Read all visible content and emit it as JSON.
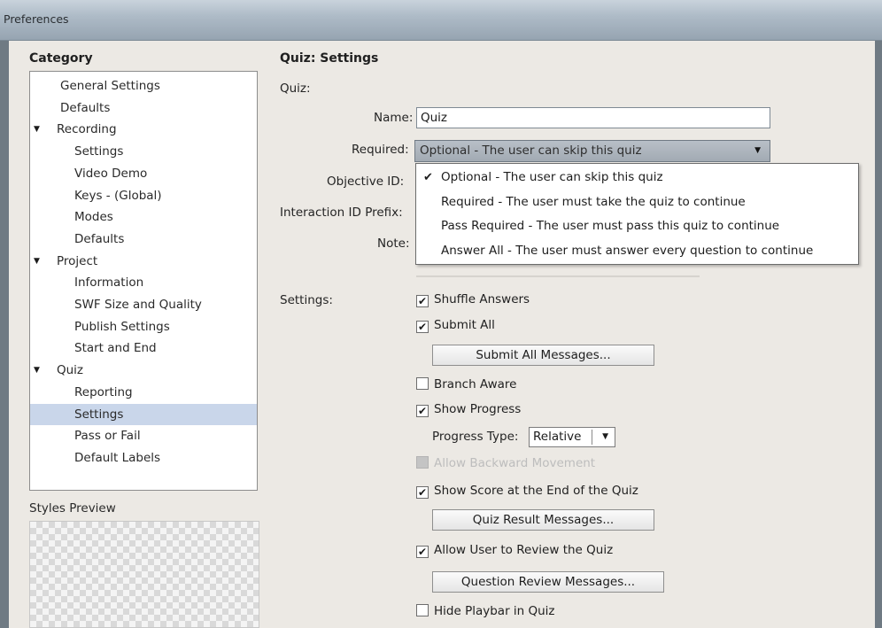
{
  "window": {
    "title": "Preferences"
  },
  "category": {
    "heading": "Category",
    "items": [
      {
        "label": "General Settings",
        "level": 1,
        "expander": ""
      },
      {
        "label": "Defaults",
        "level": 1,
        "expander": ""
      },
      {
        "label": "Recording",
        "level": 1,
        "expander": "▼"
      },
      {
        "label": "Settings",
        "level": 2,
        "expander": ""
      },
      {
        "label": "Video Demo",
        "level": 2,
        "expander": ""
      },
      {
        "label": "Keys - (Global)",
        "level": 2,
        "expander": ""
      },
      {
        "label": "Modes",
        "level": 2,
        "expander": ""
      },
      {
        "label": "Defaults",
        "level": 2,
        "expander": ""
      },
      {
        "label": "Project",
        "level": 1,
        "expander": "▼"
      },
      {
        "label": "Information",
        "level": 2,
        "expander": ""
      },
      {
        "label": "SWF Size and Quality",
        "level": 2,
        "expander": ""
      },
      {
        "label": "Publish Settings",
        "level": 2,
        "expander": ""
      },
      {
        "label": "Start and End",
        "level": 2,
        "expander": ""
      },
      {
        "label": "Quiz",
        "level": 1,
        "expander": "▼"
      },
      {
        "label": "Reporting",
        "level": 2,
        "expander": ""
      },
      {
        "label": "Settings",
        "level": 2,
        "expander": "",
        "selected": true
      },
      {
        "label": "Pass or Fail",
        "level": 2,
        "expander": ""
      },
      {
        "label": "Default Labels",
        "level": 2,
        "expander": ""
      }
    ]
  },
  "styles_preview": {
    "label": "Styles Preview"
  },
  "panel": {
    "title": "Quiz: Settings",
    "quiz_label": "Quiz:",
    "name_label": "Name:",
    "name_value": "Quiz",
    "required_label": "Required:",
    "required_value": "Optional - The user can skip this quiz",
    "objective_label": "Objective ID:",
    "interaction_label": "Interaction ID Prefix:",
    "note_label": "Note:",
    "required_options": [
      {
        "label": "Optional - The user can skip this quiz",
        "checked": true
      },
      {
        "label": "Required - The user must take the quiz to continue",
        "checked": false
      },
      {
        "label": "Pass Required - The user must pass this quiz to continue",
        "checked": false
      },
      {
        "label": "Answer All - The user must answer every question to continue",
        "checked": false
      }
    ],
    "settings_label": "Settings:",
    "shuffle_answers": {
      "label": "Shuffle Answers",
      "checked": true
    },
    "submit_all": {
      "label": "Submit All",
      "checked": true
    },
    "submit_all_messages_button": "Submit All Messages...",
    "branch_aware": {
      "label": "Branch Aware",
      "checked": false
    },
    "show_progress": {
      "label": "Show Progress",
      "checked": true
    },
    "progress_type_label": "Progress Type:",
    "progress_type_value": "Relative",
    "disabled_option": {
      "label": "Allow Backward Movement",
      "checked": false
    },
    "show_score": {
      "label": "Show Score at the End of the Quiz",
      "checked": true
    },
    "quiz_result_messages_button": "Quiz Result Messages...",
    "allow_review": {
      "label": "Allow User to Review the Quiz",
      "checked": true
    },
    "question_review_messages_button": "Question Review Messages...",
    "hide_playbar": {
      "label": "Hide Playbar in Quiz",
      "checked": false
    }
  },
  "icons": {
    "check": "✔",
    "expand_arrow": "▼",
    "dropdown_arrow": "▼"
  }
}
